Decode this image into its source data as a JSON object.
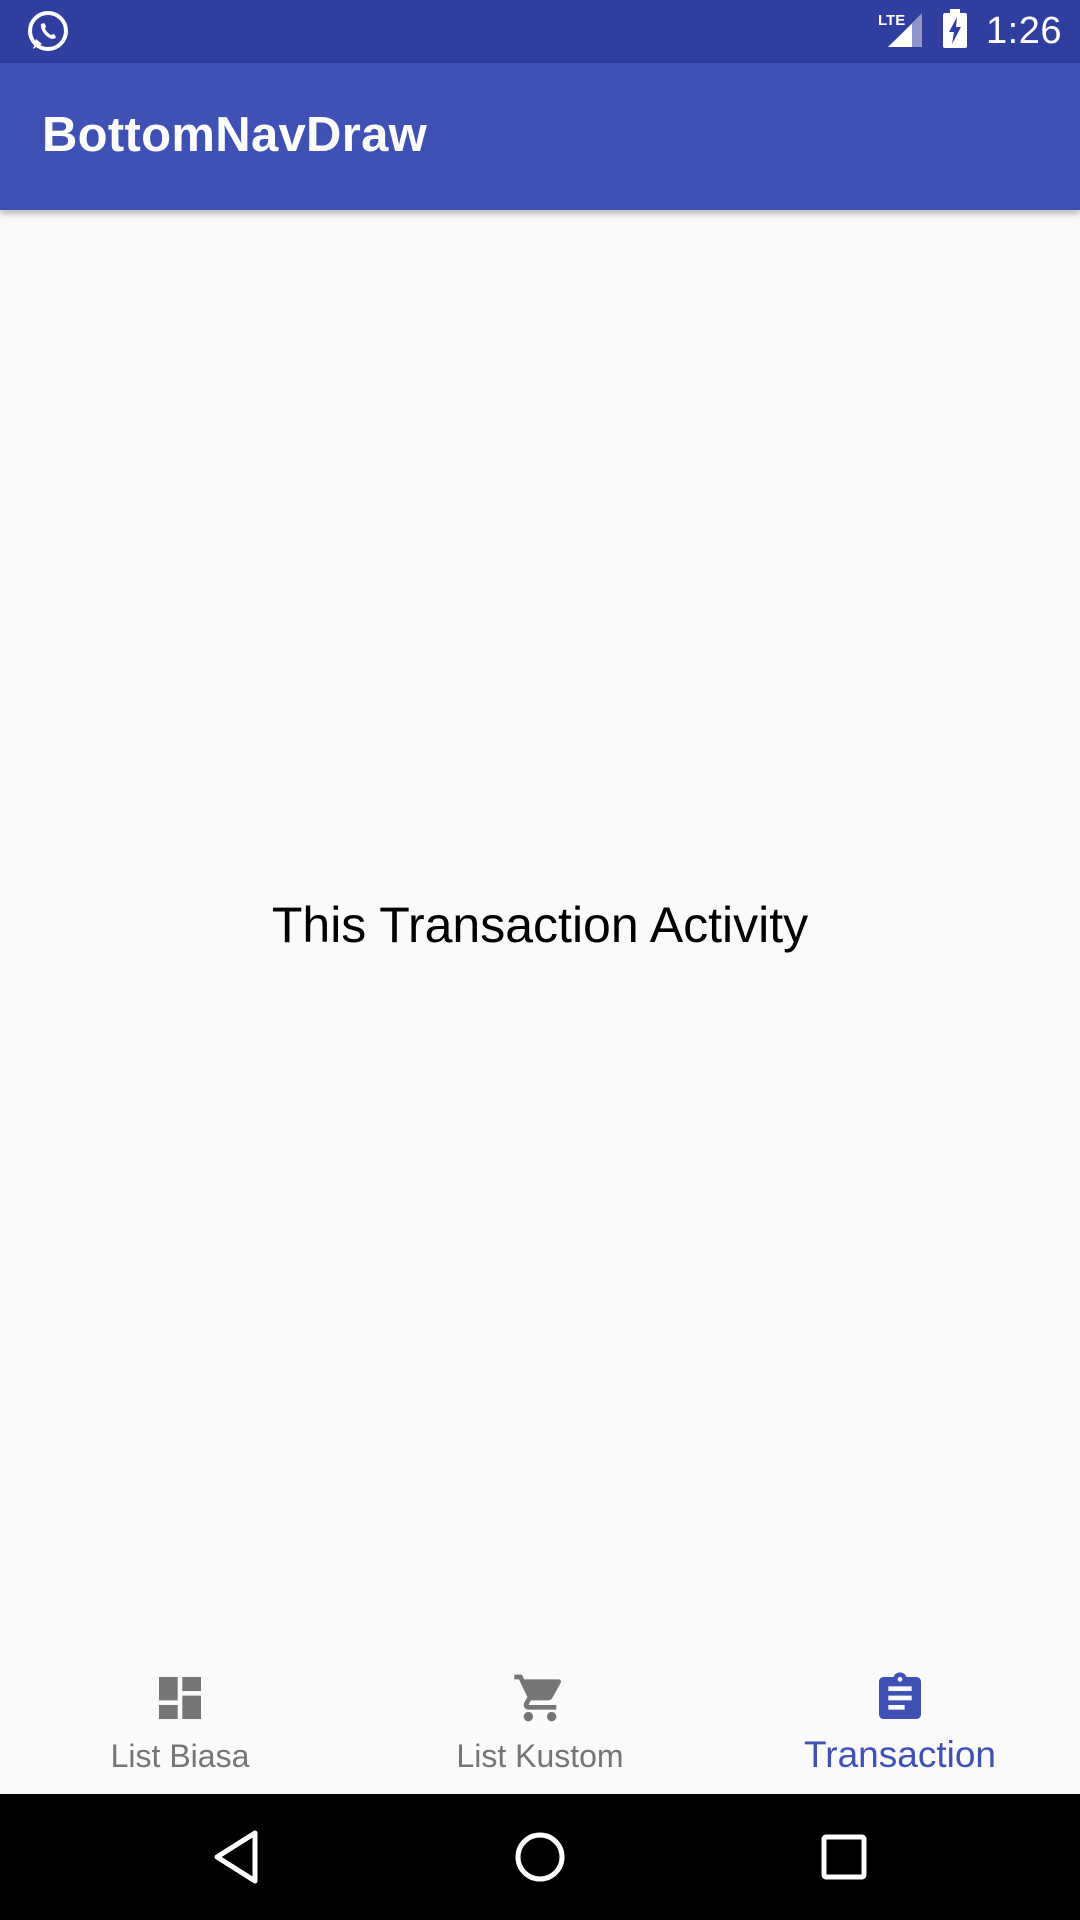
{
  "status_bar": {
    "time": "1:26",
    "network": "LTE",
    "notification_icon": "whatsapp-icon",
    "background": "#303f9f"
  },
  "app_bar": {
    "title": "BottomNavDraw",
    "background": "#3f51b5"
  },
  "content": {
    "message": "This Transaction Activity"
  },
  "bottom_nav": {
    "items": [
      {
        "label": "List Biasa",
        "icon": "dashboard-icon",
        "active": false
      },
      {
        "label": "List Kustom",
        "icon": "cart-icon",
        "active": false
      },
      {
        "label": "Transaction",
        "icon": "clipboard-icon",
        "active": true
      }
    ],
    "active_color": "#3f51b5",
    "inactive_color": "#757575"
  },
  "system_nav": {
    "buttons": [
      "back-icon",
      "home-icon",
      "recents-icon"
    ]
  }
}
